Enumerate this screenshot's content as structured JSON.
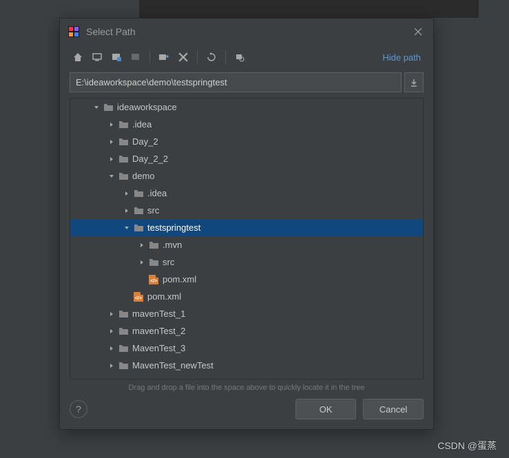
{
  "dialog": {
    "title": "Select Path",
    "hide_path_link": "Hide path",
    "path_value": "E:\\ideaworkspace\\demo\\testspringtest",
    "hint": "Drag and drop a file into the space above to quickly locate it in the tree",
    "ok_label": "OK",
    "cancel_label": "Cancel"
  },
  "tree": [
    {
      "depth": 0,
      "arrow": "down",
      "icon": "folder",
      "label": "ideaworkspace",
      "selected": false
    },
    {
      "depth": 1,
      "arrow": "right",
      "icon": "folder",
      "label": ".idea",
      "selected": false
    },
    {
      "depth": 1,
      "arrow": "right",
      "icon": "folder",
      "label": "Day_2",
      "selected": false
    },
    {
      "depth": 1,
      "arrow": "right",
      "icon": "folder",
      "label": "Day_2_2",
      "selected": false
    },
    {
      "depth": 1,
      "arrow": "down",
      "icon": "folder",
      "label": "demo",
      "selected": false
    },
    {
      "depth": 2,
      "arrow": "right",
      "icon": "folder",
      "label": ".idea",
      "selected": false
    },
    {
      "depth": 2,
      "arrow": "right",
      "icon": "folder",
      "label": "src",
      "selected": false
    },
    {
      "depth": 2,
      "arrow": "down",
      "icon": "folder",
      "label": "testspringtest",
      "selected": true
    },
    {
      "depth": 3,
      "arrow": "right",
      "icon": "folder",
      "label": ".mvn",
      "selected": false
    },
    {
      "depth": 3,
      "arrow": "right",
      "icon": "folder",
      "label": "src",
      "selected": false
    },
    {
      "depth": 3,
      "arrow": "none",
      "icon": "xml",
      "label": "pom.xml",
      "selected": false
    },
    {
      "depth": 2,
      "arrow": "none",
      "icon": "xml",
      "label": "pom.xml",
      "selected": false
    },
    {
      "depth": 1,
      "arrow": "right",
      "icon": "folder",
      "label": "mavenTest_1",
      "selected": false
    },
    {
      "depth": 1,
      "arrow": "right",
      "icon": "folder",
      "label": "mavenTest_2",
      "selected": false
    },
    {
      "depth": 1,
      "arrow": "right",
      "icon": "folder",
      "label": "MavenTest_3",
      "selected": false
    },
    {
      "depth": 1,
      "arrow": "right",
      "icon": "folder",
      "label": "MavenTest_newTest",
      "selected": false
    }
  ],
  "watermark": "CSDN @蛋蒸"
}
